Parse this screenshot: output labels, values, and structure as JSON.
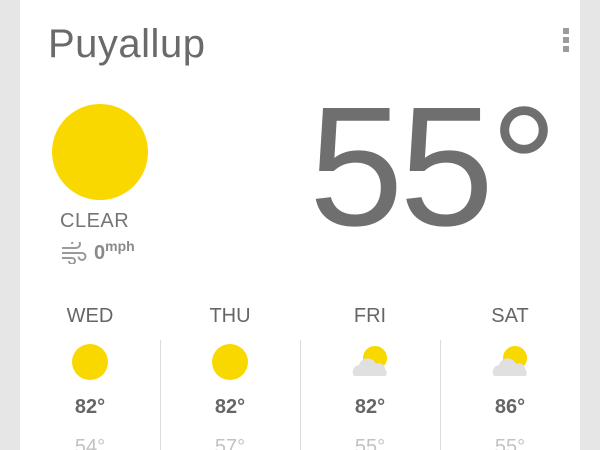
{
  "location": "Puyallup",
  "current": {
    "condition": "CLEAR",
    "temperature": "55°",
    "wind_speed": "0",
    "wind_unit": "mph",
    "icon": "sun-icon"
  },
  "forecast": [
    {
      "day": "WED",
      "icon": "sun-icon",
      "high": "82°",
      "low": "54°"
    },
    {
      "day": "THU",
      "icon": "sun-icon",
      "high": "82°",
      "low": "57°"
    },
    {
      "day": "FRI",
      "icon": "partly-cloudy-icon",
      "high": "82°",
      "low": "55°"
    },
    {
      "day": "SAT",
      "icon": "partly-cloudy-icon",
      "high": "86°",
      "low": "55°"
    }
  ],
  "colors": {
    "sun": "#f9d800",
    "cloud": "#e0e0e0",
    "text": "#666666",
    "low_text": "#c2c2c2"
  }
}
